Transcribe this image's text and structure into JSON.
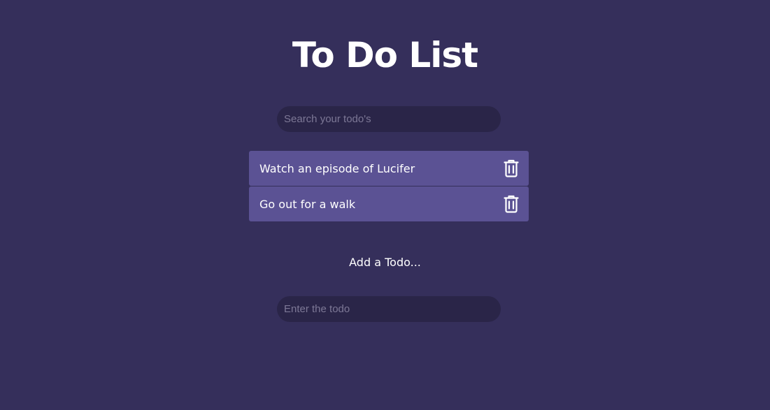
{
  "page": {
    "title": "To Do List"
  },
  "search": {
    "placeholder": "Search your todo's",
    "value": ""
  },
  "todos": [
    {
      "text": "Watch an episode of Lucifer",
      "icon": "trash-icon"
    },
    {
      "text": "Go out for a walk",
      "icon": "trash-icon"
    }
  ],
  "add": {
    "label": "Add a Todo...",
    "placeholder": "Enter the todo",
    "value": ""
  },
  "colors": {
    "background": "#352f5b",
    "input_background": "#2a2548",
    "todo_background": "#5b5294",
    "text": "#ffffff"
  }
}
